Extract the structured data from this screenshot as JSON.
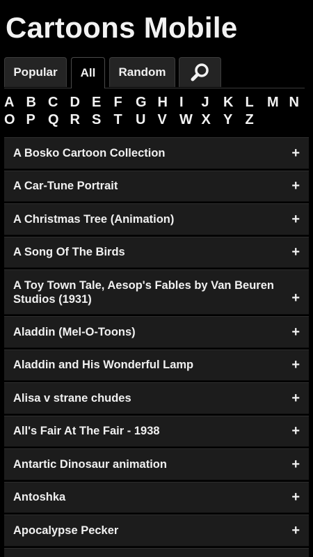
{
  "app": {
    "title": "Cartoons Mobile"
  },
  "tabs": {
    "popular": "Popular",
    "all": "All",
    "random": "Random",
    "search_icon": "search-icon",
    "active": "All"
  },
  "alphabet": {
    "row1": [
      "A",
      "B",
      "C",
      "D",
      "E",
      "F",
      "G",
      "H",
      "I",
      "J",
      "K",
      "L",
      "M",
      "N"
    ],
    "row2": [
      "O",
      "P",
      "Q",
      "R",
      "S",
      "T",
      "U",
      "V",
      "W",
      "X",
      "Y",
      "Z"
    ]
  },
  "list": {
    "expand_icon": "+",
    "items": [
      "A Bosko Cartoon Collection",
      "A Car-Tune Portrait",
      "A Christmas Tree (Animation)",
      "A Song Of The Birds",
      "A Toy Town Tale, Aesop's Fables by Van Beuren Studios (1931)",
      "Aladdin (Mel-O-Toons)",
      "Aladdin and His Wonderful Lamp",
      "Alisa v strane chudes",
      "All's Fair At The Fair - 1938",
      "Antartic Dinosaur animation",
      "Antoshka",
      "Apocalypse Pecker",
      ""
    ]
  },
  "colors": {
    "background": "#000000",
    "item_background": "#1c1c1c",
    "text": "#f0f0f0"
  }
}
